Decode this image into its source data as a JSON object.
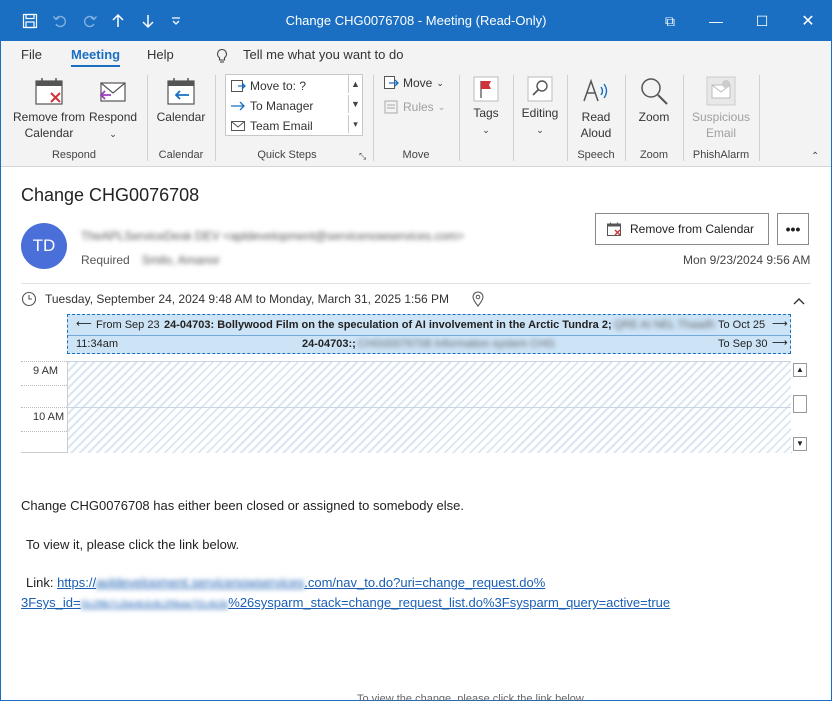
{
  "window": {
    "title": "Change CHG0076708  -  Meeting  (Read-Only)",
    "controls": {
      "restore": "⧉",
      "minimize": "—",
      "maximize": "☐",
      "close": "✕"
    }
  },
  "menu": {
    "tabs": [
      "File",
      "Meeting",
      "Help"
    ],
    "active": "Meeting",
    "tell_me": "Tell me what you want to do"
  },
  "ribbon": {
    "respond": {
      "remove_label_1": "Remove from",
      "remove_label_2": "Calendar",
      "respond_label": "Respond",
      "group": "Respond"
    },
    "calendar": {
      "label": "Calendar",
      "group": "Calendar"
    },
    "quick_steps": {
      "items": [
        "Move to: ?",
        "To Manager",
        "Team Email"
      ],
      "group": "Quick Steps"
    },
    "move": {
      "move_label": "Move",
      "rules_label": "Rules",
      "group": "Move"
    },
    "tags": {
      "label": "Tags"
    },
    "editing": {
      "label": "Editing"
    },
    "speech": {
      "read_1": "Read",
      "read_2": "Aloud",
      "group": "Speech"
    },
    "zoom": {
      "label": "Zoom",
      "group": "Zoom"
    },
    "phish": {
      "label_1": "Suspicious",
      "label_2": "Email",
      "group": "PhishAlarm"
    }
  },
  "message": {
    "subject": "Change CHG0076708",
    "avatar_initials": "TD",
    "sender": "TheAPLServiceDesk DEV <apldevelopment@servicenowservices.com>",
    "required_label": "Required",
    "required_names": "Smilo, Amanor",
    "remove_button": "Remove from Calendar",
    "more_button": "•••",
    "date": "Mon 9/23/2024 9:56 AM",
    "when": "Tuesday, September 24, 2024 9:48 AM to Monday, March 31, 2025 1:56 PM"
  },
  "calendar": {
    "row1": {
      "from": "From Sep 23",
      "title": "24-04703: Bollywood Film on the speculation of AI involvement in the Arctic Tundra 2;",
      "tail_blur": "QRE AI NEL Thaadh",
      "to": "To Oct 25"
    },
    "row2": {
      "time": "11:34am",
      "title": "24-04703:;",
      "tail_blur": "CHG00076708 Information system CHG",
      "to": "To Sep 30"
    },
    "times": [
      "9 AM",
      "10 AM"
    ]
  },
  "body": {
    "line1": "Change CHG0076708 has either been closed or assigned to somebody else.",
    "line2": "To view it, please click the link below.",
    "link_label": "Link:",
    "link_part1": "https://",
    "link_blur1": "apldevelopment.servicenowservices",
    "link_part2": ".com/nav_to.do?uri=change_request.do%",
    "link_part3": "3Fsys_id=",
    "link_blur2": "f3c2f8b7c2bb4b3c8c2f9bda7f2c4b3b",
    "link_part4": "%26sysparm_stack=change_request_list.do%3Fsysparm_query=active=true",
    "ghost": "To view the change, please click the link below."
  }
}
